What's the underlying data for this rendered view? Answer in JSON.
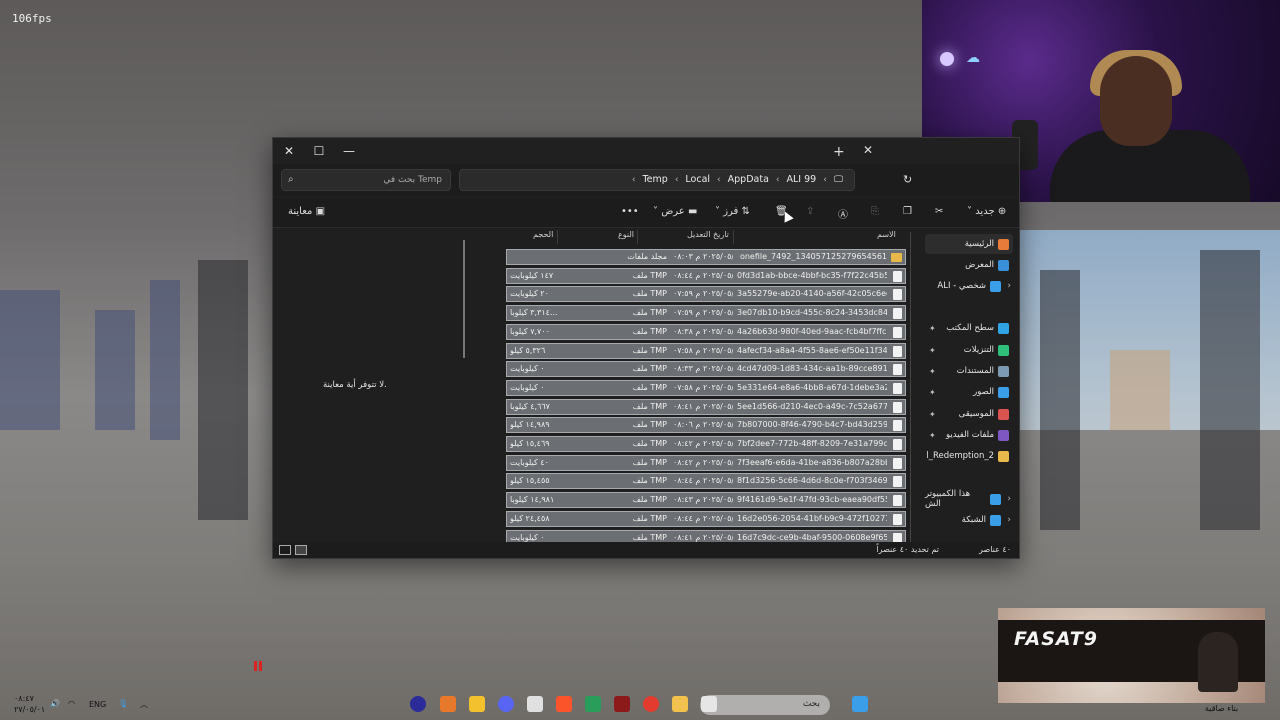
{
  "overlay": {
    "fps": "106fps"
  },
  "window": {
    "tab_add": "+",
    "tab_close": "✕",
    "close": "✕",
    "maximize": "☐",
    "minimize": "—"
  },
  "search": {
    "placeholder": "بحث في Temp"
  },
  "breadcrumbs": [
    "ALI 99",
    "AppData",
    "Local",
    "Temp"
  ],
  "toolbar": {
    "new_label": "جديد",
    "sort_label": "فرز",
    "view_label": "عرض",
    "more_label": "•••",
    "preview_label": "معاينة"
  },
  "preview": {
    "message": "لا تتوفر أية معاينة."
  },
  "columns": {
    "name": "الاسم",
    "date": "تاريخ التعديل",
    "type": "النوع",
    "size": "الحجم"
  },
  "sidebar": {
    "items": [
      {
        "label": "الرئيسية",
        "color": "#e77b3a",
        "selected": true
      },
      {
        "label": "المعرض",
        "color": "#3a8fd9"
      },
      {
        "label": "ALI - شخصي",
        "color": "#3a9ee8",
        "expandable": true
      },
      {
        "label": "سطح المكتب",
        "color": "#2fa3e4",
        "pinned": true
      },
      {
        "label": "التنزيلات",
        "color": "#2fbf7a",
        "pinned": true
      },
      {
        "label": "المستندات",
        "color": "#7c9ab3",
        "pinned": true
      },
      {
        "label": "الصور",
        "color": "#3a9ee8",
        "pinned": true
      },
      {
        "label": "الموسيقى",
        "color": "#d9534f",
        "pinned": true
      },
      {
        "label": "ملفات الفيديو",
        "color": "#7e57c2",
        "pinned": true
      },
      {
        "label": "l_Redemption_2",
        "color": "#e8b84a"
      },
      {
        "label": "هذا الكمبيوتر الش",
        "color": "#3a9ee8",
        "expandable": true
      },
      {
        "label": "الشبكة",
        "color": "#3a9ee8",
        "expandable": true
      }
    ]
  },
  "files": [
    {
      "name": "onefile_7492_134057125279654561",
      "date": "٢٠٢٥/٠٥/٠١ م ٠٨:٠٣",
      "type": "مجلد ملفات",
      "size": "",
      "folder": true
    },
    {
      "name": "0fd3d1ab-bbce-4bbf-bc35-f7f22c45b59f....",
      "date": "٢٠٢٥/٠٥/٠١ م ٠٨:٤٤",
      "type": "ملف TMP",
      "size": "١٤٧ كيلوبايت"
    },
    {
      "name": "3a55279e-ab20-4140-a56f-42c05c6eef90.t...",
      "date": "٢٠٢٥/٠٥/٠١ م ٠٧:٥٩",
      "type": "ملف TMP",
      "size": "٢٠ كيلوبايت"
    },
    {
      "name": "3e07db10-b9cd-455c-8c24-3453dc84560a...",
      "date": "٢٠٢٥/٠٥/٠١ م ٠٧:٥٩",
      "type": "ملف TMP",
      "size": "٣,٣١٤ كيلوبا..."
    },
    {
      "name": "4a26b63d-980f-40ed-9aac-fcb4bf7ffc0f.t...",
      "date": "٢٠٢٥/٠٥/٠١ م ٠٨:٣٨",
      "type": "ملف TMP",
      "size": "٧,٧٠٠ كيلوبا"
    },
    {
      "name": "4afecf34-a8a4-4f55-8ae6-ef50e11f343c.t...",
      "date": "٢٠٢٥/٠٥/٠١ م ٠٧:٥٨",
      "type": "ملف TMP",
      "size": "٥,٣٢٦ كيلو"
    },
    {
      "name": "4cd47d09-1d83-434c-aa1b-89cce891afbf....",
      "date": "٢٠٢٥/٠٥/٠١ م ٠٨:٣٣",
      "type": "ملف TMP",
      "size": "٠ كيلوبايت"
    },
    {
      "name": "5e331e64-e8a6-4bb8-a67d-1debe3a2b6d...",
      "date": "٢٠٢٥/٠٥/٠١ م ٠٧:٥٨",
      "type": "ملف TMP",
      "size": "٠ كيلوبايت"
    },
    {
      "name": "5ee1d566-d210-4ec0-a49c-7c52a677d109...",
      "date": "٢٠٢٥/٠٥/٠١ م ٠٨:٤١",
      "type": "ملف TMP",
      "size": "٤,٦٦٧ كيلوبا"
    },
    {
      "name": "7b807000-8f46-4790-b4c7-bd43d2596870...",
      "date": "٢٠٢٥/٠٥/٠١ م ٠٨:٠٦",
      "type": "ملف TMP",
      "size": "١٤,٩٨٩ كيلو"
    },
    {
      "name": "7bf2dee7-772b-48ff-8209-7e31a799cdc3.t...",
      "date": "٢٠٢٥/٠٥/٠١ م ٠٨:٤٢",
      "type": "ملف TMP",
      "size": "١٥,٤٦٩ كيلو"
    },
    {
      "name": "7f3eeaf6-e6da-41be-a836-b807a28bbace....",
      "date": "٢٠٢٥/٠٥/٠١ م ٠٨:٤٢",
      "type": "ملف TMP",
      "size": "٤٠ كيلوبايت"
    },
    {
      "name": "8f1d3256-5c66-4d6d-8c0e-f703f3469924.t...",
      "date": "٢٠٢٥/٠٥/٠١ م ٠٨:٤٤",
      "type": "ملف TMP",
      "size": "١٥,٤٥٥ كيلو"
    },
    {
      "name": "9f4161d9-5e1f-47fd-93cb-eaea90df55e5.t...",
      "date": "٢٠٢٥/٠٥/٠١ م ٠٨:٤٣",
      "type": "ملف TMP",
      "size": "١٤,٩٨١ كيلوبا"
    },
    {
      "name": "16d2e056-2054-41bf-b9c9-472f10271e4c....",
      "date": "٢٠٢٥/٠٥/٠١ م ٠٨:٤٤",
      "type": "ملف TMP",
      "size": "٢٤,٤٥٨ كيلو"
    },
    {
      "name": "16d7c9dc-ce9b-4baf-9500-0608e9f65eec....",
      "date": "٢٠٢٥/٠٥/٠١ م ٠٨:٤١",
      "type": "ملف TMP",
      "size": "٠ كيلوبايت"
    }
  ],
  "status": {
    "count": "٤٠ عناصر",
    "selected": "تم تحديد ٤٠ عنصراً"
  },
  "logo": {
    "text": "FASAT9",
    "caption": "بتاء صاقية"
  },
  "taskbar": {
    "time": "٠٨:٤٧",
    "date": "٢٧/٠٥/٠١",
    "lang": "ENG",
    "search_placeholder": "بحث"
  }
}
